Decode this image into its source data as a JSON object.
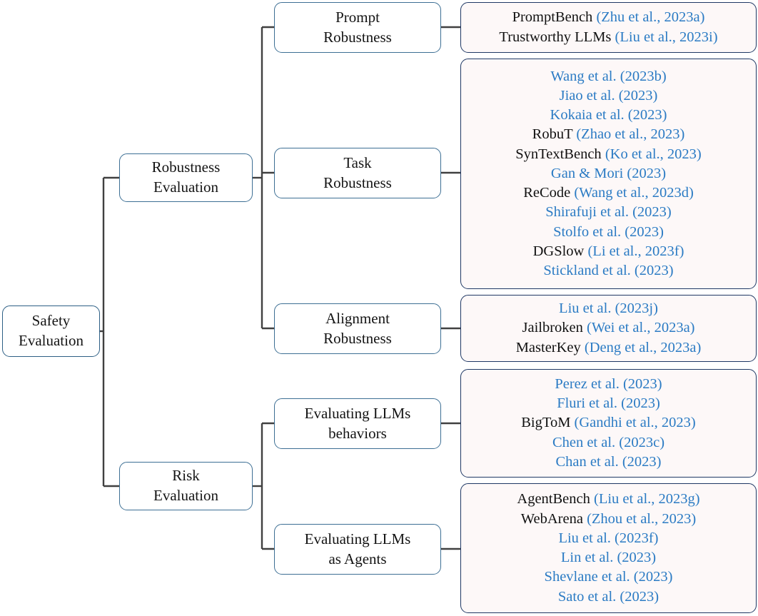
{
  "figure": {
    "type": "taxonomy-tree",
    "root": {
      "label": "Safety\nEvaluation"
    },
    "colors": {
      "leaf_fill": "#fdf8f8",
      "leaf_border": "#1f3864",
      "category_border": "#3d6f94",
      "citation_text": "#2b7bc4",
      "body_text": "#111111",
      "connector": "#404040"
    },
    "categories": [
      {
        "id": "robustness-evaluation",
        "label": "Robustness\nEvaluation",
        "subcategories": [
          {
            "id": "prompt-robustness",
            "label": "Prompt\nRobustness",
            "entries": [
              {
                "name": "PromptBench",
                "citation": "(Zhu et al., 2023a)"
              },
              {
                "name": "Trustworthy LLMs",
                "citation": "(Liu et al., 2023i)"
              }
            ]
          },
          {
            "id": "task-robustness",
            "label": "Task\nRobustness",
            "entries": [
              {
                "name": "",
                "citation": "Wang et al. (2023b)"
              },
              {
                "name": "",
                "citation": "Jiao et al. (2023)"
              },
              {
                "name": "",
                "citation": "Kokaia et al. (2023)"
              },
              {
                "name": "RobuT",
                "citation": "(Zhao et al., 2023)"
              },
              {
                "name": "SynTextBench",
                "citation": "(Ko et al., 2023)"
              },
              {
                "name": "",
                "citation": "Gan & Mori (2023)"
              },
              {
                "name": "ReCode",
                "citation": "(Wang et al., 2023d)"
              },
              {
                "name": "",
                "citation": "Shirafuji et al. (2023)"
              },
              {
                "name": "",
                "citation": "Stolfo et al. (2023)"
              },
              {
                "name": "DGSlow",
                "citation": "(Li et al., 2023f)"
              },
              {
                "name": "",
                "citation": "Stickland et al. (2023)"
              }
            ]
          },
          {
            "id": "alignment-robustness",
            "label": "Alignment\nRobustness",
            "entries": [
              {
                "name": "",
                "citation": "Liu et al. (2023j)"
              },
              {
                "name": "Jailbroken",
                "citation": "(Wei et al., 2023a)"
              },
              {
                "name": "MasterKey",
                "citation": "(Deng et al., 2023a)"
              }
            ]
          }
        ]
      },
      {
        "id": "risk-evaluation",
        "label": "Risk\nEvaluation",
        "subcategories": [
          {
            "id": "evaluating-llms-behaviors",
            "label": "Evaluating LLMs\nbehaviors",
            "entries": [
              {
                "name": "",
                "citation": "Perez et al. (2023)"
              },
              {
                "name": "",
                "citation": "Fluri et al. (2023)"
              },
              {
                "name": "BigToM",
                "citation": "(Gandhi et al., 2023)"
              },
              {
                "name": "",
                "citation": "Chen et al. (2023c)"
              },
              {
                "name": "",
                "citation": "Chan et al. (2023)"
              }
            ]
          },
          {
            "id": "evaluating-llms-as-agents",
            "label": "Evaluating LLMs\nas Agents",
            "entries": [
              {
                "name": "AgentBench",
                "citation": "(Liu et al., 2023g)"
              },
              {
                "name": "WebArena",
                "citation": "(Zhou et al., 2023)"
              },
              {
                "name": "",
                "citation": "Liu et al. (2023f)"
              },
              {
                "name": "",
                "citation": "Lin et al. (2023)"
              },
              {
                "name": "",
                "citation": "Shevlane et al. (2023)"
              },
              {
                "name": "",
                "citation": "Sato et al. (2023)"
              }
            ]
          }
        ]
      }
    ]
  }
}
